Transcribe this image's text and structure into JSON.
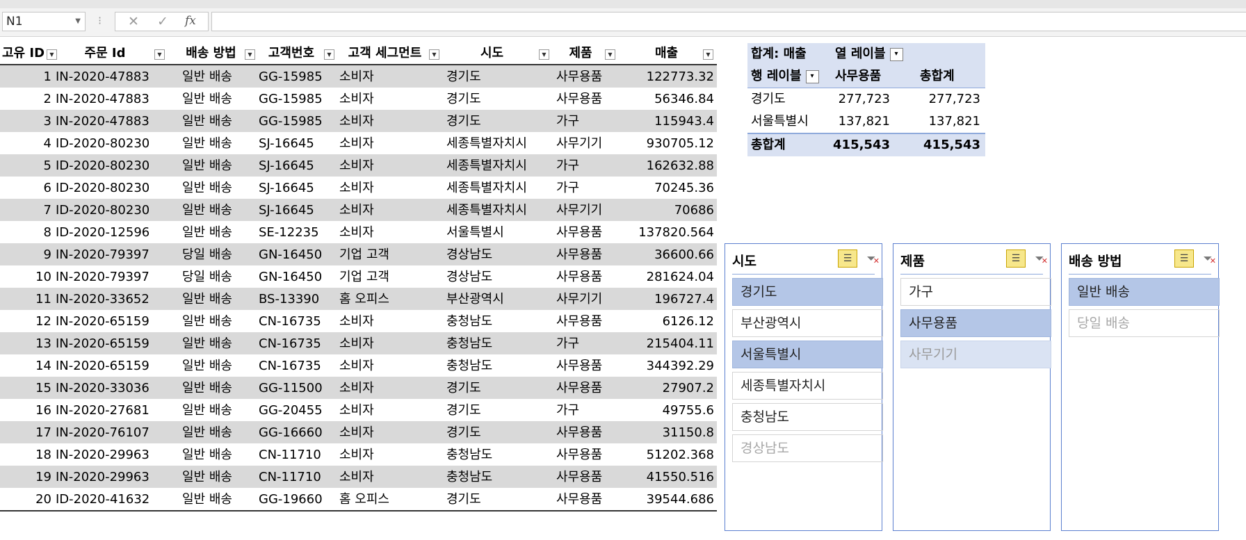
{
  "formula_bar": {
    "name_box": "N1",
    "cancel_icon": "✕",
    "enter_icon": "✓",
    "fx_label": "fx",
    "formula": ""
  },
  "table": {
    "headers": [
      "고유 ID",
      "주문 Id",
      "배송 방법",
      "고객번호",
      "고객 세그먼트",
      "시도",
      "제품",
      "매출"
    ],
    "rows": [
      [
        "1",
        "IN-2020-47883",
        "일반 배송",
        "GG-15985",
        "소비자",
        "경기도",
        "사무용품",
        "122773.32"
      ],
      [
        "2",
        "IN-2020-47883",
        "일반 배송",
        "GG-15985",
        "소비자",
        "경기도",
        "사무용품",
        "56346.84"
      ],
      [
        "3",
        "IN-2020-47883",
        "일반 배송",
        "GG-15985",
        "소비자",
        "경기도",
        "가구",
        "115943.4"
      ],
      [
        "4",
        "ID-2020-80230",
        "일반 배송",
        "SJ-16645",
        "소비자",
        "세종특별자치시",
        "사무기기",
        "930705.12"
      ],
      [
        "5",
        "ID-2020-80230",
        "일반 배송",
        "SJ-16645",
        "소비자",
        "세종특별자치시",
        "가구",
        "162632.88"
      ],
      [
        "6",
        "ID-2020-80230",
        "일반 배송",
        "SJ-16645",
        "소비자",
        "세종특별자치시",
        "가구",
        "70245.36"
      ],
      [
        "7",
        "ID-2020-80230",
        "일반 배송",
        "SJ-16645",
        "소비자",
        "세종특별자치시",
        "사무기기",
        "70686"
      ],
      [
        "8",
        "ID-2020-12596",
        "일반 배송",
        "SE-12235",
        "소비자",
        "서울특별시",
        "사무용품",
        "137820.564"
      ],
      [
        "9",
        "IN-2020-79397",
        "당일 배송",
        "GN-16450",
        "기업 고객",
        "경상남도",
        "사무용품",
        "36600.66"
      ],
      [
        "10",
        "IN-2020-79397",
        "당일 배송",
        "GN-16450",
        "기업 고객",
        "경상남도",
        "사무용품",
        "281624.04"
      ],
      [
        "11",
        "IN-2020-33652",
        "일반 배송",
        "BS-13390",
        "홈 오피스",
        "부산광역시",
        "사무기기",
        "196727.4"
      ],
      [
        "12",
        "IN-2020-65159",
        "일반 배송",
        "CN-16735",
        "소비자",
        "충청남도",
        "사무용품",
        "6126.12"
      ],
      [
        "13",
        "IN-2020-65159",
        "일반 배송",
        "CN-16735",
        "소비자",
        "충청남도",
        "가구",
        "215404.11"
      ],
      [
        "14",
        "IN-2020-65159",
        "일반 배송",
        "CN-16735",
        "소비자",
        "충청남도",
        "사무용품",
        "344392.29"
      ],
      [
        "15",
        "IN-2020-33036",
        "일반 배송",
        "GG-11500",
        "소비자",
        "경기도",
        "사무용품",
        "27907.2"
      ],
      [
        "16",
        "IN-2020-27681",
        "일반 배송",
        "GG-20455",
        "소비자",
        "경기도",
        "가구",
        "49755.6"
      ],
      [
        "17",
        "IN-2020-76107",
        "일반 배송",
        "GG-16660",
        "소비자",
        "경기도",
        "사무용품",
        "31150.8"
      ],
      [
        "18",
        "IN-2020-29963",
        "일반 배송",
        "CN-11710",
        "소비자",
        "충청남도",
        "사무용품",
        "51202.368"
      ],
      [
        "19",
        "IN-2020-29963",
        "일반 배송",
        "CN-11710",
        "소비자",
        "충청남도",
        "사무용품",
        "41550.516"
      ],
      [
        "20",
        "ID-2020-41632",
        "일반 배송",
        "GG-19660",
        "홈 오피스",
        "경기도",
        "사무용품",
        "39544.686"
      ]
    ]
  },
  "pivot": {
    "value_label": "합계: 매출",
    "col_label": "열 레이블",
    "row_label": "행 레이블",
    "col_item": "사무용품",
    "grand_total_col": "총합계",
    "rows": [
      {
        "label": "경기도",
        "value": "277,723",
        "total": "277,723"
      },
      {
        "label": "서울특별시",
        "value": "137,821",
        "total": "137,821"
      }
    ],
    "grand_total": {
      "label": "총합계",
      "value": "415,543",
      "total": "415,543"
    }
  },
  "slicers": [
    {
      "title": "시도",
      "items": [
        {
          "label": "경기도",
          "state": "selected"
        },
        {
          "label": "부산광역시",
          "state": "normal"
        },
        {
          "label": "서울특별시",
          "state": "selected"
        },
        {
          "label": "세종특별자치시",
          "state": "normal"
        },
        {
          "label": "충청남도",
          "state": "normal"
        },
        {
          "label": "경상남도",
          "state": "nodata"
        }
      ]
    },
    {
      "title": "제품",
      "items": [
        {
          "label": "가구",
          "state": "normal"
        },
        {
          "label": "사무용품",
          "state": "selected"
        },
        {
          "label": "사무기기",
          "state": "selected-nodata"
        }
      ]
    },
    {
      "title": "배송 방법",
      "items": [
        {
          "label": "일반 배송",
          "state": "selected"
        },
        {
          "label": "당일 배송",
          "state": "nodata"
        }
      ]
    }
  ],
  "colors": {
    "alt_row": "#d9d9d9",
    "pivot_header": "#d9e1f2",
    "slicer_selected": "#b4c6e7",
    "slicer_border": "#5b7fcf"
  }
}
